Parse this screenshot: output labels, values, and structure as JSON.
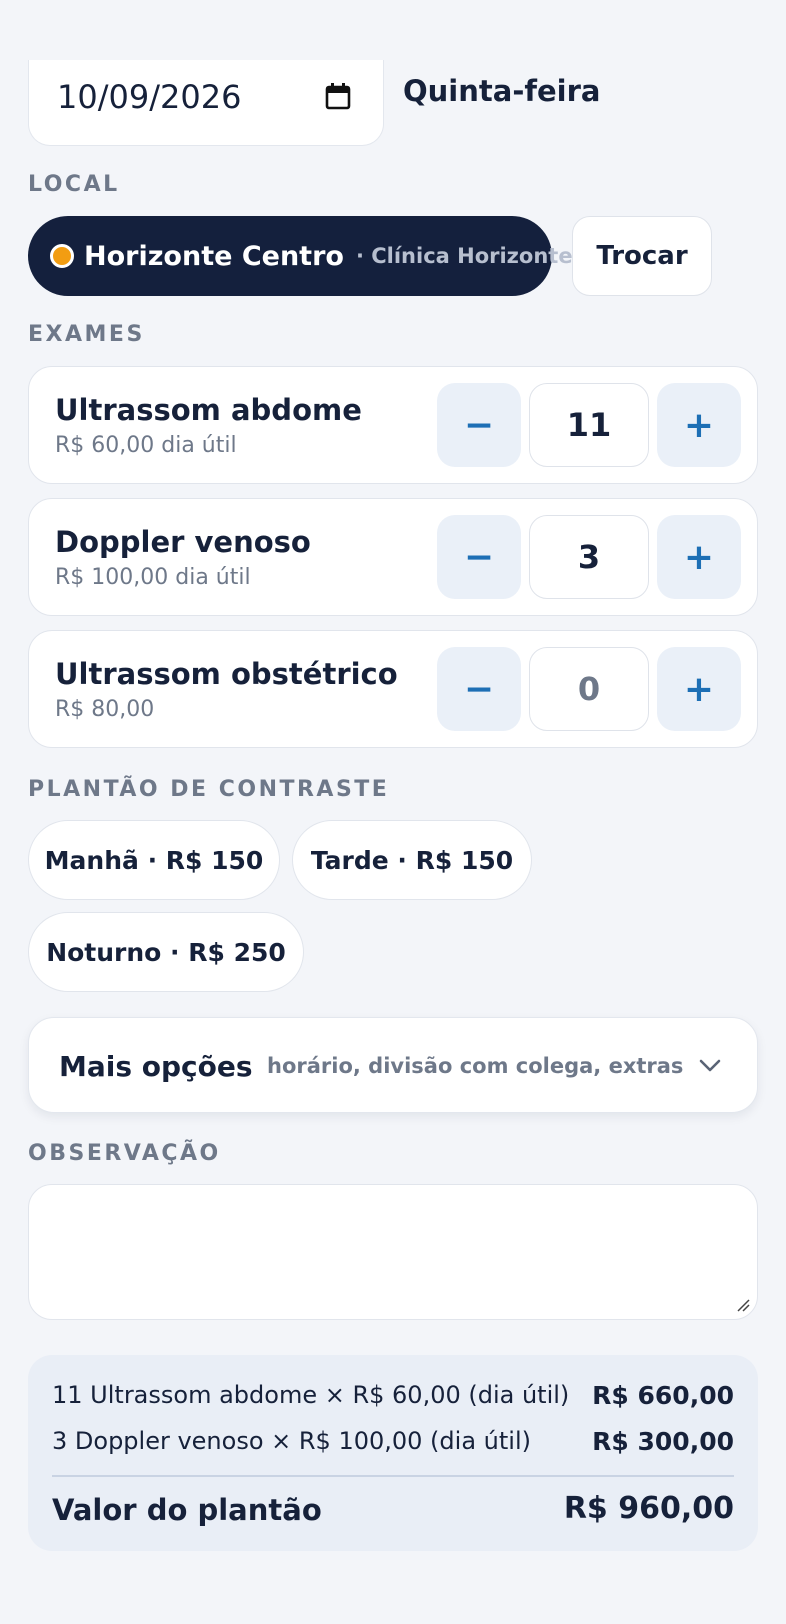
{
  "date": {
    "value": "10/09/2026",
    "weekday": "Quinta-feira"
  },
  "location": {
    "label": "LOCAL",
    "name": "Horizonte Centro",
    "clinic": "· Clínica Horizonte",
    "dot_color": "#f29d12",
    "swap_label": "Trocar"
  },
  "exams": {
    "label": "EXAMES",
    "items": [
      {
        "name": "Ultrassom abdome",
        "price": "R$ 60,00 dia útil",
        "count": "11"
      },
      {
        "name": "Doppler venoso",
        "price": "R$ 100,00 dia útil",
        "count": "3"
      },
      {
        "name": "Ultrassom obstétrico",
        "price": "R$ 80,00",
        "count": "0"
      }
    ],
    "minus_label": "−",
    "plus_label": "+"
  },
  "contrast": {
    "label": "PLANTÃO DE CONTRASTE",
    "options": [
      "Manhã · R$ 150",
      "Tarde · R$ 150",
      "Noturno · R$ 250"
    ]
  },
  "more_options": {
    "title": "Mais opções",
    "hint": "horário, divisão com colega, extras"
  },
  "observation": {
    "label": "OBSERVAÇÃO",
    "value": ""
  },
  "summary": {
    "lines": [
      {
        "text": "11 Ultrassom abdome × R$ 60,00 (dia útil)",
        "amount": "R$ 660,00"
      },
      {
        "text": "3 Doppler venoso × R$ 100,00 (dia útil)",
        "amount": "R$ 300,00"
      }
    ],
    "total_label": "Valor do plantão",
    "total_amount": "R$ 960,00"
  },
  "colors": {
    "accent": "#1d6fb5",
    "dark_pill": "#14203d",
    "background": "#f3f5f9"
  }
}
